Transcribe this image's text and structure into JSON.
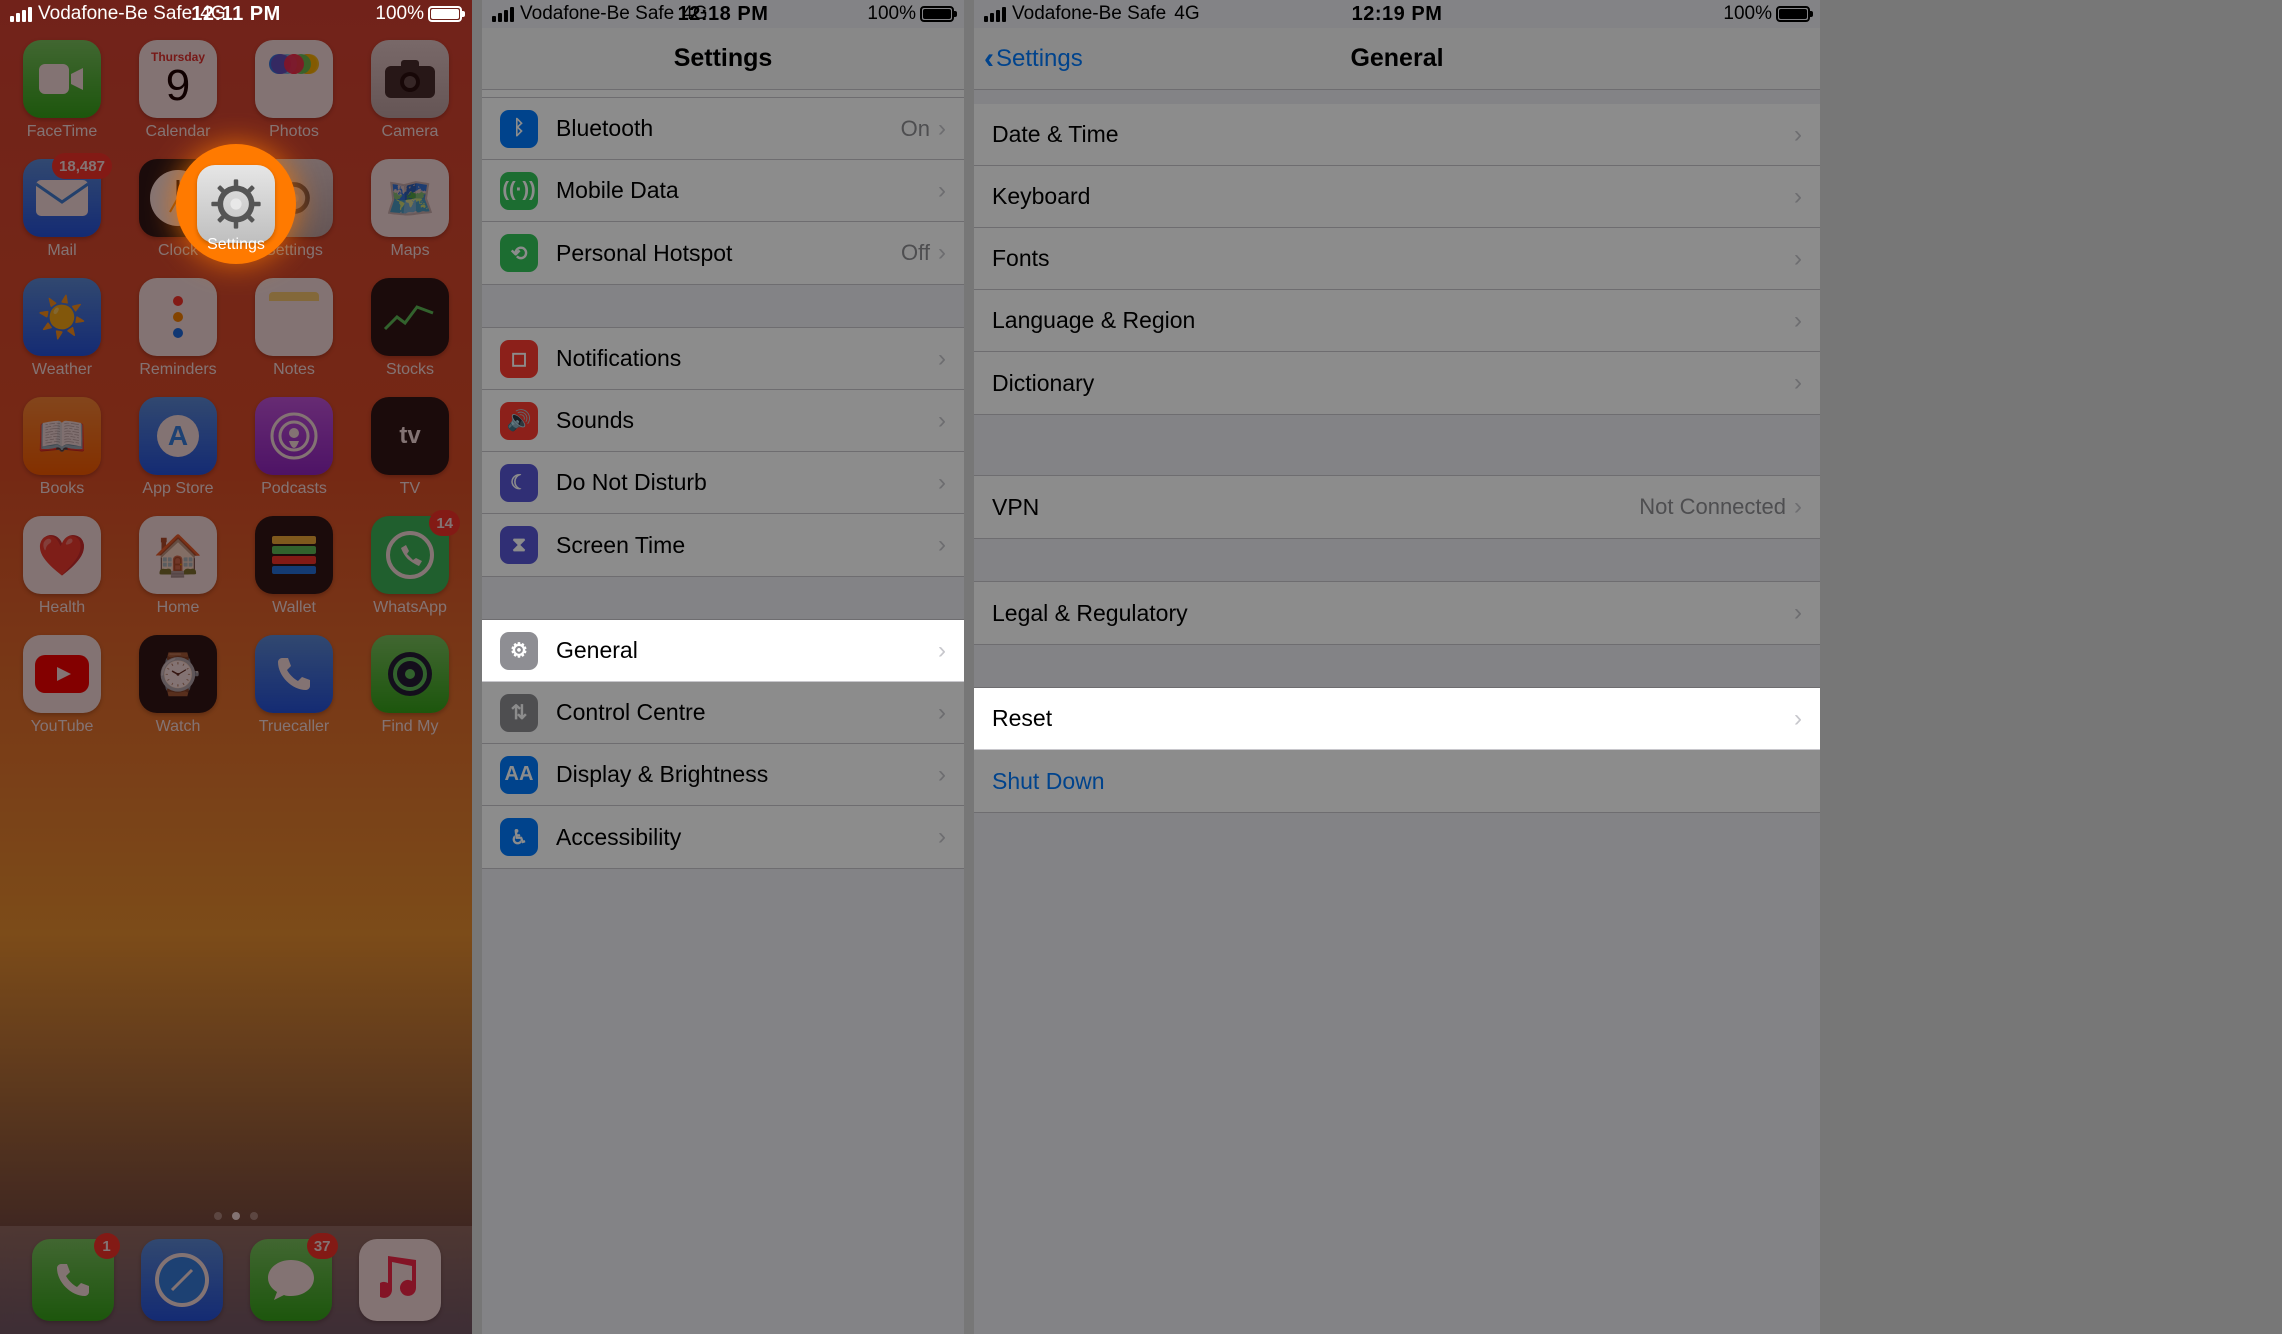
{
  "panel1": {
    "status": {
      "carrier": "Vodafone-Be Safe",
      "net": "4G",
      "time": "12:11 PM",
      "battery": "100%"
    },
    "highlighted_app": "Settings",
    "apps": [
      {
        "label": "FaceTime",
        "bg": "bg-green",
        "badge": null,
        "icon": "video"
      },
      {
        "label": "Calendar",
        "bg": "bg-white",
        "badge": null,
        "icon": "calendar",
        "cal_day": "Thursday",
        "cal_num": "9"
      },
      {
        "label": "Photos",
        "bg": "bg-white",
        "badge": null,
        "icon": "photos"
      },
      {
        "label": "Camera",
        "bg": "bg-grey",
        "badge": null,
        "icon": "camera"
      },
      {
        "label": "Mail",
        "bg": "bg-blue",
        "badge": "18,487",
        "icon": "mail"
      },
      {
        "label": "Clock",
        "bg": "bg-black",
        "badge": null,
        "icon": "clock"
      },
      {
        "label": "Settings",
        "bg": "bg-grey",
        "badge": null,
        "icon": "gear"
      },
      {
        "label": "Maps",
        "bg": "bg-white",
        "badge": null,
        "icon": "maps"
      },
      {
        "label": "Weather",
        "bg": "bg-blue",
        "badge": null,
        "icon": "weather"
      },
      {
        "label": "Reminders",
        "bg": "bg-white",
        "badge": null,
        "icon": "reminders"
      },
      {
        "label": "Notes",
        "bg": "bg-white",
        "badge": null,
        "icon": "notes"
      },
      {
        "label": "Stocks",
        "bg": "bg-black",
        "badge": null,
        "icon": "stocks"
      },
      {
        "label": "Books",
        "bg": "bg-orange",
        "badge": null,
        "icon": "books"
      },
      {
        "label": "App Store",
        "bg": "bg-blue",
        "badge": null,
        "icon": "appstore"
      },
      {
        "label": "Podcasts",
        "bg": "bg-purple",
        "badge": null,
        "icon": "podcasts"
      },
      {
        "label": "TV",
        "bg": "bg-black",
        "badge": null,
        "icon": "tv"
      },
      {
        "label": "Health",
        "bg": "bg-white",
        "badge": null,
        "icon": "health"
      },
      {
        "label": "Home",
        "bg": "bg-white",
        "badge": null,
        "icon": "home"
      },
      {
        "label": "Wallet",
        "bg": "bg-black",
        "badge": null,
        "icon": "wallet"
      },
      {
        "label": "WhatsApp",
        "bg": "bg-wa",
        "badge": "14",
        "icon": "whatsapp"
      },
      {
        "label": "YouTube",
        "bg": "bg-white",
        "badge": null,
        "icon": "youtube"
      },
      {
        "label": "Watch",
        "bg": "bg-black",
        "badge": null,
        "icon": "watch"
      },
      {
        "label": "Truecaller",
        "bg": "bg-blue",
        "badge": null,
        "icon": "phone"
      },
      {
        "label": "Find My",
        "bg": "bg-green",
        "badge": null,
        "icon": "findmy"
      }
    ],
    "dock": [
      {
        "label": "Phone",
        "bg": "bg-green",
        "badge": "1",
        "icon": "phone"
      },
      {
        "label": "Safari",
        "bg": "bg-blue",
        "badge": null,
        "icon": "safari"
      },
      {
        "label": "Messages",
        "bg": "bg-green",
        "badge": "37",
        "icon": "messages"
      },
      {
        "label": "Music",
        "bg": "bg-white",
        "badge": null,
        "icon": "music"
      }
    ]
  },
  "panel2": {
    "status": {
      "carrier": "Vodafone-Be Safe",
      "net": "4G",
      "time": "12:18 PM",
      "battery": "100%"
    },
    "title": "Settings",
    "rows": [
      {
        "icon": "bluetooth",
        "bg": "#007aff",
        "label": "Bluetooth",
        "value": "On"
      },
      {
        "icon": "antenna",
        "bg": "#34c759",
        "label": "Mobile Data",
        "value": ""
      },
      {
        "icon": "hotspot",
        "bg": "#34c759",
        "label": "Personal Hotspot",
        "value": "Off"
      }
    ],
    "rows2": [
      {
        "icon": "bell",
        "bg": "#ff3b30",
        "label": "Notifications"
      },
      {
        "icon": "speaker",
        "bg": "#ff3b30",
        "label": "Sounds"
      },
      {
        "icon": "moon",
        "bg": "#5856d6",
        "label": "Do Not Disturb"
      },
      {
        "icon": "hourglass",
        "bg": "#5856d6",
        "label": "Screen Time"
      }
    ],
    "rows3": [
      {
        "icon": "gear",
        "bg": "#8e8e93",
        "label": "General"
      },
      {
        "icon": "switches",
        "bg": "#8e8e93",
        "label": "Control Centre"
      },
      {
        "icon": "aa",
        "bg": "#007aff",
        "label": "Display & Brightness"
      },
      {
        "icon": "access",
        "bg": "#007aff",
        "label": "Accessibility"
      }
    ],
    "highlight": "General"
  },
  "panel3": {
    "status": {
      "carrier": "Vodafone-Be Safe",
      "net": "4G",
      "time": "12:19 PM",
      "battery": "100%"
    },
    "back": "Settings",
    "title": "General",
    "g1": [
      "Date & Time",
      "Keyboard",
      "Fonts",
      "Language & Region",
      "Dictionary"
    ],
    "g2": [
      {
        "label": "VPN",
        "value": "Not Connected"
      }
    ],
    "g3": [
      "Legal & Regulatory"
    ],
    "g4": [
      "Reset"
    ],
    "g5": [
      "Shut Down"
    ],
    "highlight": "Reset"
  }
}
